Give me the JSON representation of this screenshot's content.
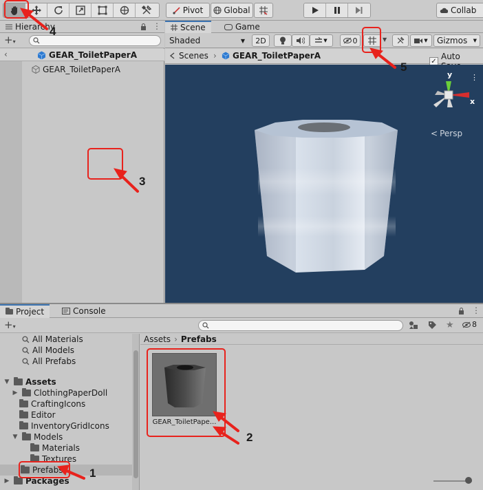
{
  "toolbar": {
    "tools": [
      "hand-tool",
      "move-tool",
      "rotate-tool",
      "scale-tool",
      "rect-tool",
      "transform-tool",
      "custom-tool"
    ],
    "pivot_label": "Pivot",
    "global_label": "Global",
    "collab_label": "Collab"
  },
  "hierarchy": {
    "tab_label": "Hierarchy",
    "header_object": "GEAR_ToiletPaperA",
    "items": [
      "GEAR_ToiletPaperA"
    ]
  },
  "scene": {
    "tab_scene": "Scene",
    "tab_game": "Game",
    "shading": "Shaded",
    "mode_2d": "2D",
    "hidden_count": "0",
    "gizmos_label": "Gizmos",
    "breadcrumb_root": "Scenes",
    "breadcrumb_object": "GEAR_ToiletPaperA",
    "autosave_label": "Auto Save",
    "persp_label": "Persp",
    "axis_y": "y",
    "axis_x": "x"
  },
  "project": {
    "tab_project": "Project",
    "tab_console": "Console",
    "hidden_count": "8",
    "breadcrumb_root": "Assets",
    "breadcrumb_current": "Prefabs",
    "favorites": [
      "All Materials",
      "All Models",
      "All Prefabs"
    ],
    "assets_label": "Assets",
    "folders": [
      "ClothingPaperDoll",
      "CraftingIcons",
      "Editor",
      "InventoryGridIcons",
      "Models",
      "Materials",
      "Textures",
      "Prefabs"
    ],
    "packages_label": "Packages",
    "asset_name": "GEAR_ToiletPape..."
  },
  "annotations": [
    "1",
    "2",
    "3",
    "4",
    "5"
  ],
  "colors": {
    "annotation": "#e8221c",
    "scene_bg": "#233f5f",
    "selection": "#b5b5b5",
    "accent": "#3a72b0"
  }
}
